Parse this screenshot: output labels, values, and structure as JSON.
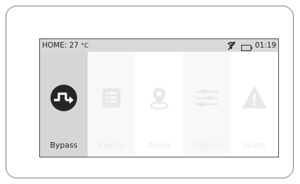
{
  "status": {
    "home_label": "HOME: 27",
    "temp_unit": "°C",
    "time": "01:19",
    "signal_icon": "no-signal-icon",
    "battery_icon": "battery-icon"
  },
  "tiles": [
    {
      "label": "Bypass",
      "icon": "bypass-icon",
      "active": true
    },
    {
      "label": "Events",
      "icon": "events-list-icon",
      "active": false
    },
    {
      "label": "Zones",
      "icon": "zone-location-icon",
      "active": false
    },
    {
      "label": "Outputs",
      "icon": "outputs-sliders-icon",
      "active": false
    },
    {
      "label": "Faults",
      "icon": "fault-warning-icon",
      "active": false
    }
  ],
  "colors": {
    "active_tile": "#d6d6d6",
    "icon_active": "#262626",
    "icon_inactive": "#e8e8e8"
  }
}
